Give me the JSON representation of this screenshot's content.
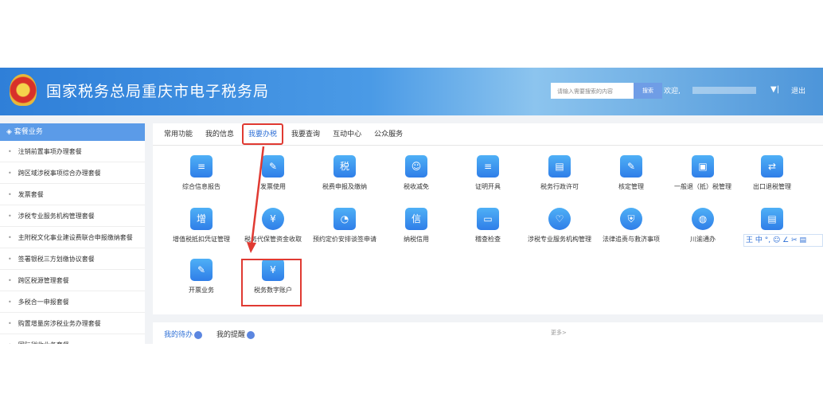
{
  "header": {
    "title": "国家税务总局重庆市电子税务局",
    "search_placeholder": "请输入需要搜索的内容",
    "search_button": "搜索",
    "welcome": "欢迎,",
    "logout": "退出",
    "dropdown": "▼|"
  },
  "sidebar": {
    "title": "套餐业务",
    "items": [
      "注销前置事项办理套餐",
      "跨区域涉税事项综合办理套餐",
      "发票套餐",
      "涉税专业服务机构管理套餐",
      "主附税文化事业建设费联合申报缴纳套餐",
      "签署银税三方划缴协议套餐",
      "跨区税源管理套餐",
      "多税合一申报套餐",
      "购置增量房涉税业务办理套餐",
      "国际税收业务套餐"
    ]
  },
  "tabs": [
    "常用功能",
    "我的信息",
    "我要办税",
    "我要查询",
    "互动中心",
    "公众服务"
  ],
  "active_tab": "我要办税",
  "services": [
    {
      "label": "综合信息报告",
      "icon": "report-icon",
      "g": "≡"
    },
    {
      "label": "发票使用",
      "icon": "invoice-icon",
      "g": "✎"
    },
    {
      "label": "税费申报及缴纳",
      "icon": "tax-declare-icon",
      "g": "税"
    },
    {
      "label": "税收减免",
      "icon": "tax-relief-icon",
      "g": "☺"
    },
    {
      "label": "证明开具",
      "icon": "certificate-icon",
      "g": "≡"
    },
    {
      "label": "税务行政许可",
      "icon": "permit-icon",
      "g": "▤"
    },
    {
      "label": "核定管理",
      "icon": "clipboard-icon",
      "g": "✎"
    },
    {
      "label": "一般退（抵）税管理",
      "icon": "briefcase-icon",
      "g": "▣"
    },
    {
      "label": "出口退税管理",
      "icon": "export-icon",
      "g": "⇄"
    },
    {
      "label": "增值税抵扣凭证管理",
      "icon": "vat-icon",
      "g": "增"
    },
    {
      "label": "税务代保管资金收取",
      "icon": "money-bag-icon",
      "g": "¥"
    },
    {
      "label": "预约定价安排谈签申请",
      "icon": "pricing-icon",
      "g": "◔"
    },
    {
      "label": "纳税信用",
      "icon": "credit-icon",
      "g": "信"
    },
    {
      "label": "稽查检查",
      "icon": "monitor-icon",
      "g": "▭"
    },
    {
      "label": "涉税专业服务机构管理",
      "icon": "heart-hand-icon",
      "g": "♡"
    },
    {
      "label": "法律追责与救济事项",
      "icon": "shield-icon",
      "g": "⛨"
    },
    {
      "label": "川渝通办",
      "icon": "globe-icon",
      "g": "◍"
    },
    {
      "label": "",
      "icon": "id-card-icon",
      "g": "▤"
    },
    {
      "label": "开票业务",
      "icon": "issue-invoice-icon",
      "g": "✎"
    },
    {
      "label": "税务数字账户",
      "icon": "digital-account-icon",
      "g": "¥"
    }
  ],
  "bottom": {
    "todo": "我的待办",
    "reminder": "我的提醒",
    "more": "更多>"
  },
  "ime": "王 中 °, ☺ ∠ ✂ ▤"
}
